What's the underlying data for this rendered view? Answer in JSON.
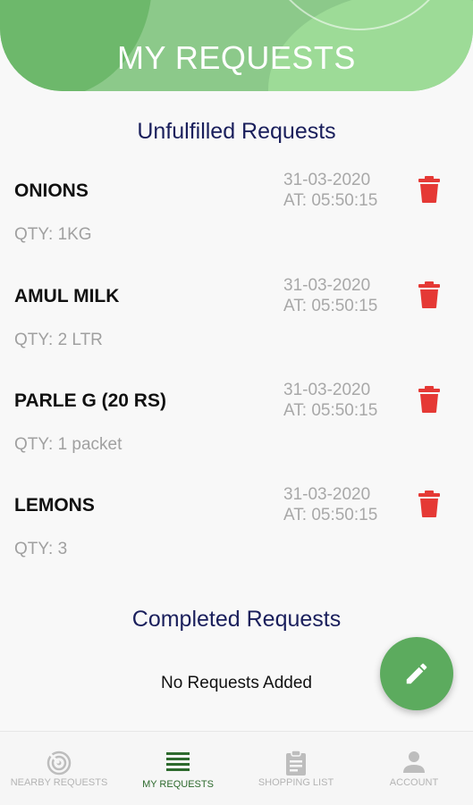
{
  "header": {
    "title": "MY REQUESTS"
  },
  "sections": {
    "unfulfilled_title": "Unfulfilled Requests",
    "completed_title": "Completed Requests",
    "completed_empty": "No Requests Added"
  },
  "requests": [
    {
      "name": "ONIONS",
      "qty": "QTY: 1KG",
      "date": "31-03-2020",
      "time": "AT: 05:50:15"
    },
    {
      "name": "AMUL MILK",
      "qty": "QTY: 2 LTR",
      "date": "31-03-2020",
      "time": "AT: 05:50:15"
    },
    {
      "name": "PARLE G (20 RS)",
      "qty": "QTY: 1 packet",
      "date": "31-03-2020",
      "time": "AT: 05:50:15"
    },
    {
      "name": "LEMONS",
      "qty": "QTY: 3",
      "date": "31-03-2020",
      "time": "AT: 05:50:15"
    }
  ],
  "nav": [
    {
      "label": "NEARBY REQUESTS",
      "icon": "radar-icon",
      "active": false
    },
    {
      "label": "MY REQUESTS",
      "icon": "list-icon",
      "active": true
    },
    {
      "label": "SHOPPING LIST",
      "icon": "clipboard-icon",
      "active": false
    },
    {
      "label": "ACCOUNT",
      "icon": "person-icon",
      "active": false
    }
  ],
  "fab": {
    "icon": "pencil-icon"
  },
  "colors": {
    "accent_green": "#5cab5e",
    "header_green": "#8cc98a",
    "delete_red": "#e53935",
    "section_title": "#1a1f5c",
    "active_nav": "#2d6a2d"
  }
}
